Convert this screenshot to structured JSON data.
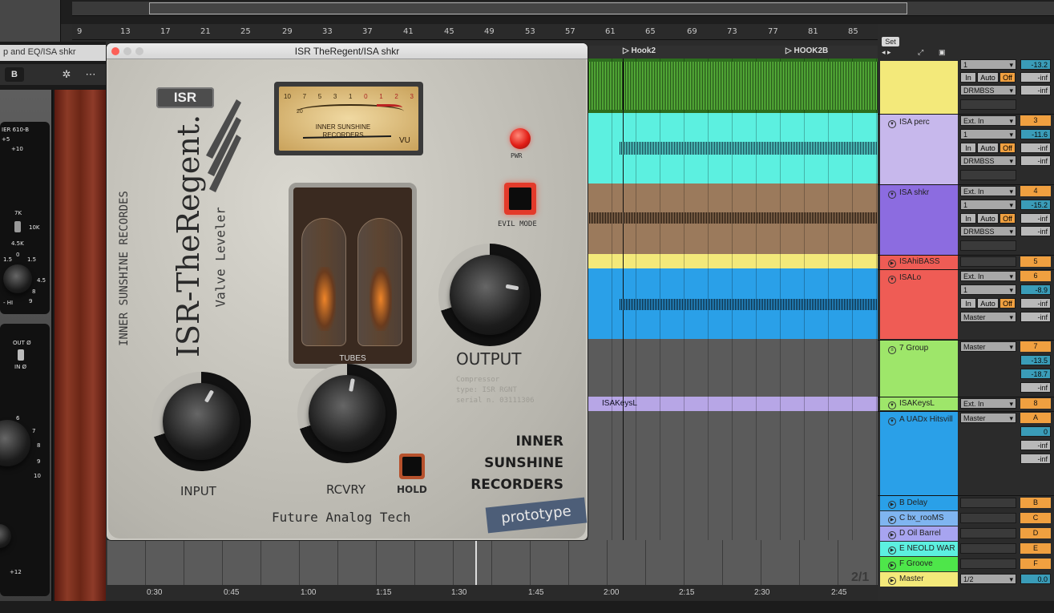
{
  "left_window": {
    "title": "p and EQ/ISA shkr",
    "tool_b": "B",
    "eq_labels": {
      "model": "IER 610-B",
      "plus5": "+5",
      "plus10": "+10",
      "k7": "7K",
      "k10": "10K",
      "k45": "4.5K",
      "l15": "1.5",
      "zero": "0",
      "r15": "1.5",
      "v45": "4.5",
      "hi": "- HI",
      "v9": "9",
      "v8": "8",
      "out": "OUT Ø",
      "in": "IN Ø",
      "v6": "6",
      "v7": "7",
      "v5": "5",
      "n8": "8",
      "n9": "9",
      "n10": "10",
      "p12": "+12"
    }
  },
  "bar_numbers": [
    "9",
    "13",
    "17",
    "21",
    "25",
    "29",
    "33",
    "37",
    "41",
    "45",
    "49",
    "53",
    "57",
    "61",
    "65",
    "69",
    "73",
    "77",
    "81",
    "85"
  ],
  "locators": [
    "Hook2",
    "HOOK2B"
  ],
  "plugin": {
    "window_title": "ISR TheRegent/ISA shkr",
    "badge": "ISR",
    "product_name": "ISR-TheRegent.",
    "product_sub": "Valve Leveler",
    "vertical_brand": "INNER SUNSHINE RECORDES",
    "vu": {
      "scale": [
        "10",
        "7",
        "5",
        "3",
        "1",
        "0",
        "1",
        "2",
        "3"
      ],
      "minus20": "20",
      "brand_line1": "INNER SUNSHINE",
      "brand_line2": "RECORDERS",
      "unit": "VU"
    },
    "tubes_label": "TUBES",
    "pwr_label": "PWR",
    "evil_mode_label": "EVIL MODE",
    "output_label": "OUTPUT",
    "input_label": "INPUT",
    "rcvry_label": "RCVRY",
    "hold_label": "HOLD",
    "spec_line1": "Compressor",
    "spec_line2": "type: ISR RGNT",
    "spec_line3": "serial n. 03111306",
    "maker_line1": "INNER",
    "maker_line2": "SUNSHINE",
    "maker_line3": "RECORDERS",
    "tagline": "Future Analog Tech",
    "prototype": "prototype"
  },
  "clip_labels": {
    "keys": "ISAKeysL"
  },
  "tracks": {
    "set_label": "Set",
    "rows": [
      {
        "name": "",
        "io1": "1",
        "mon": [
          "In",
          "Auto",
          "Off"
        ],
        "io2": "DRMBSS",
        "num": "",
        "vols": [
          "-13.2",
          "-inf",
          "-inf"
        ]
      },
      {
        "name": "ISA perc",
        "io0": "Ext. In",
        "io1": "1",
        "mon": [
          "In",
          "Auto",
          "Off"
        ],
        "io2": "DRMBSS",
        "num": "3",
        "vols": [
          "-11.6",
          "-inf",
          "-inf"
        ]
      },
      {
        "name": "ISA shkr",
        "io0": "Ext. In",
        "io1": "1",
        "mon": [
          "In",
          "Auto",
          "Off"
        ],
        "io2": "DRMBSS",
        "num": "4",
        "vols": [
          "-15.2",
          "-inf",
          "-inf"
        ]
      },
      {
        "name": "ISAhiBASS",
        "num": "5"
      },
      {
        "name": "ISALo",
        "io0": "Ext. In",
        "io1": "1",
        "mon": [
          "In",
          "Auto",
          "Off"
        ],
        "io2": "Master",
        "num": "6",
        "vols": [
          "-8.9",
          "-inf",
          "-inf"
        ]
      },
      {
        "name": "7 Group",
        "io0": "Master",
        "num": "7",
        "vols": [
          "-13.5",
          "-18.7",
          "-inf"
        ]
      },
      {
        "name": "ISAKeysL",
        "io0": "Ext. In",
        "num": "8"
      },
      {
        "name": "A UADx Hitsvill",
        "io0": "Master",
        "num": "A",
        "vols": [
          "0",
          "-inf",
          "-inf"
        ]
      },
      {
        "name": "B Delay",
        "num": "B"
      },
      {
        "name": "C bx_rooMS",
        "num": "C"
      },
      {
        "name": "D Oil Barrel",
        "num": "D"
      },
      {
        "name": "E NEOLD WAR",
        "num": "E"
      },
      {
        "name": "F Groove",
        "num": "F"
      },
      {
        "name": "Master",
        "io0": "1/2",
        "num": "",
        "vols": [
          "0.0"
        ]
      }
    ]
  },
  "scale_label": "2/1",
  "time_ruler": [
    "0:30",
    "0:45",
    "1:00",
    "1:15",
    "1:30",
    "1:45",
    "2:00",
    "2:15",
    "2:30",
    "2:45"
  ],
  "colors": {
    "green_track": "#58c43a",
    "cyan_track": "#5cf0e0",
    "brown_track": "#9b7a5c",
    "yellow_track": "#f3e97a",
    "blue_track": "#2aa0e8",
    "lavender_track": "#b7a6e6",
    "red_track": "#ef5c55",
    "lime_track": "#9ee66a",
    "accent_orange": "#f0a040"
  }
}
